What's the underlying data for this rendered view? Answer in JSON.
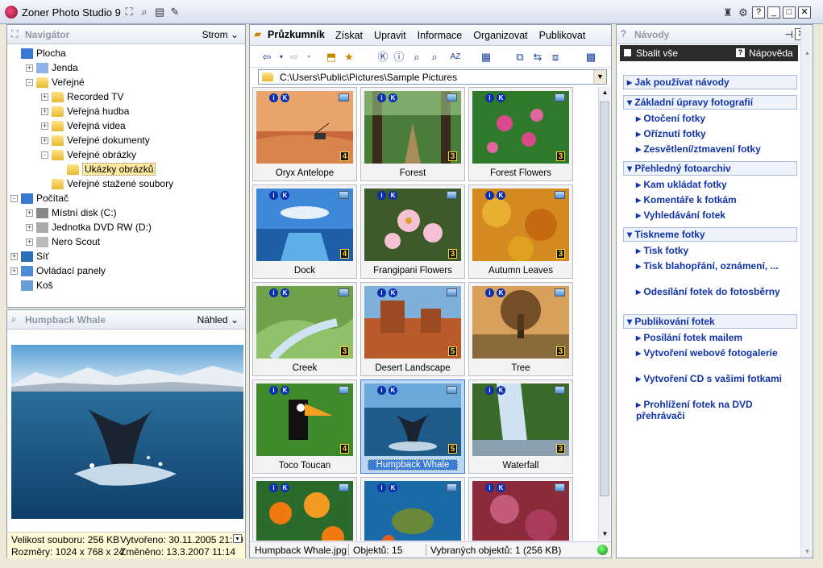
{
  "app": {
    "title": "Zoner Photo Studio 9"
  },
  "navigator": {
    "title": "Navigátor",
    "view": "Strom",
    "tree": [
      {
        "label": "Plocha",
        "level": 0,
        "exp": "",
        "icon": "desktop"
      },
      {
        "label": "Jenda",
        "level": 1,
        "exp": "+",
        "icon": "user"
      },
      {
        "label": "Veřejné",
        "level": 1,
        "exp": "-",
        "icon": "folder"
      },
      {
        "label": "Recorded TV",
        "level": 2,
        "exp": "+",
        "icon": "folder"
      },
      {
        "label": "Veřejná hudba",
        "level": 2,
        "exp": "+",
        "icon": "music"
      },
      {
        "label": "Veřejná videa",
        "level": 2,
        "exp": "+",
        "icon": "video"
      },
      {
        "label": "Veřejné dokumenty",
        "level": 2,
        "exp": "+",
        "icon": "docs"
      },
      {
        "label": "Veřejné obrázky",
        "level": 2,
        "exp": "-",
        "icon": "pictures"
      },
      {
        "label": "Ukázky obrázků",
        "level": 3,
        "exp": "",
        "icon": "folder",
        "selected": true
      },
      {
        "label": "Veřejné stažené soubory",
        "level": 2,
        "exp": "",
        "icon": "folder"
      },
      {
        "label": "Počítač",
        "level": 0,
        "exp": "-",
        "icon": "computer"
      },
      {
        "label": "Místní disk (C:)",
        "level": 1,
        "exp": "+",
        "icon": "disk"
      },
      {
        "label": "Jednotka DVD RW (D:)",
        "level": 1,
        "exp": "+",
        "icon": "dvd"
      },
      {
        "label": "Nero Scout",
        "level": 1,
        "exp": "+",
        "icon": "scout"
      },
      {
        "label": "Síť",
        "level": 0,
        "exp": "+",
        "icon": "network"
      },
      {
        "label": "Ovládací panely",
        "level": 0,
        "exp": "+",
        "icon": "control"
      },
      {
        "label": "Koš",
        "level": 0,
        "exp": "",
        "icon": "bin"
      }
    ]
  },
  "preview": {
    "title": "Humpback Whale",
    "view": "Náhled",
    "info": {
      "size": "Velikost souboru: 256 KB",
      "created": "Vytvořeno: 30.11.2005 21:20",
      "dims": "Rozměry: 1024 x 768 x 24",
      "modified": "Změněno: 13.3.2007 11:14"
    }
  },
  "explorer": {
    "title": "Průzkumník",
    "menu": [
      "Získat",
      "Upravit",
      "Informace",
      "Organizovat",
      "Publikovat"
    ],
    "path": "C:\\Users\\Public\\Pictures\\Sample Pictures",
    "thumbs": [
      {
        "name": "Oryx Antelope",
        "rating": "4",
        "scene": "desert"
      },
      {
        "name": "Forest",
        "rating": "3",
        "scene": "forest"
      },
      {
        "name": "Forest Flowers",
        "rating": "3",
        "scene": "flowers"
      },
      {
        "name": "Dock",
        "rating": "4",
        "scene": "dock"
      },
      {
        "name": "Frangipani Flowers",
        "rating": "3",
        "scene": "frangipani"
      },
      {
        "name": "Autumn Leaves",
        "rating": "3",
        "scene": "autumn"
      },
      {
        "name": "Creek",
        "rating": "3",
        "scene": "creek"
      },
      {
        "name": "Desert Landscape",
        "rating": "5",
        "scene": "canyon"
      },
      {
        "name": "Tree",
        "rating": "3",
        "scene": "tree"
      },
      {
        "name": "Toco Toucan",
        "rating": "4",
        "scene": "toucan"
      },
      {
        "name": "Humpback Whale",
        "rating": "5",
        "scene": "whale",
        "selected": true
      },
      {
        "name": "Waterfall",
        "rating": "3",
        "scene": "waterfall"
      },
      {
        "name": "",
        "rating": "",
        "scene": "orangeflowers"
      },
      {
        "name": "",
        "rating": "",
        "scene": "turtle"
      },
      {
        "name": "",
        "rating": "",
        "scene": "frost"
      }
    ],
    "status": {
      "file": "Humpback Whale.jpg",
      "count": "Objektů: 15",
      "selected": "Vybraných objektů: 1 (256 KB)"
    }
  },
  "guides": {
    "title": "Návody",
    "collapse_all": "Sbalit vše",
    "help": "Nápověda",
    "sections": [
      {
        "title": "Jak používat návody",
        "items": []
      },
      {
        "title": "Základní úpravy fotografií",
        "items": [
          "Otočení fotky",
          "Oříznutí fotky",
          "Zesvětlení/ztmavení fotky"
        ]
      },
      {
        "title": "Přehledný fotoarchiv",
        "items": [
          "Kam ukládat fotky",
          "Komentáře k fotkám",
          "Vyhledávání fotek"
        ]
      },
      {
        "title": "Tiskneme fotky",
        "items": [
          "Tisk fotky",
          "Tisk blahopřání, oznámení, ...",
          "Odesílání fotek do fotosběrny"
        ]
      },
      {
        "title": "Publikování fotek",
        "items": [
          "Posílání fotek mailem",
          "Vytvoření webové fotogalerie",
          "Vytvoření CD s vašimi fotkami",
          "Prohlížení fotek na DVD přehrávači"
        ]
      }
    ]
  }
}
